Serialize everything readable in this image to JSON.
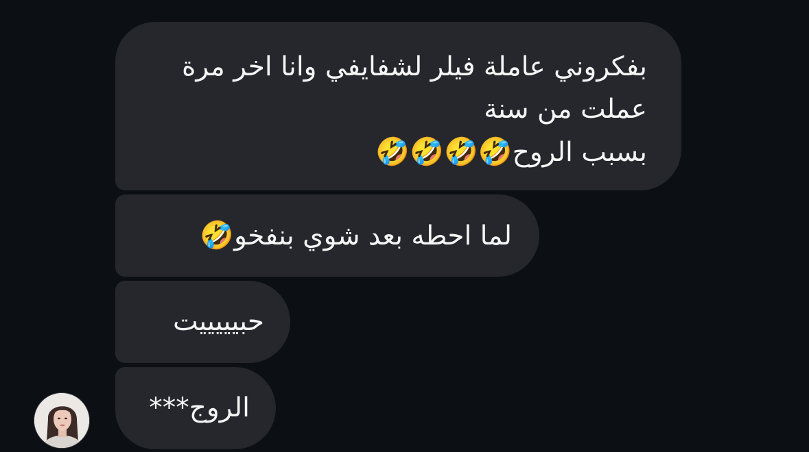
{
  "messages": [
    {
      "line1": "بفكروني عاملة فيلر لشفايفي وانا اخر مرة",
      "line2": "عملت من سنة",
      "line3_text": "بسبب الروح",
      "line3_emoji": "🤣🤣🤣🤣"
    },
    {
      "text": "لما احطه بعد شوي بنفخو",
      "emoji": "🤣"
    },
    {
      "text": "حبيييييت"
    },
    {
      "text": "الروج***"
    }
  ],
  "sender_avatar": {
    "icon": "profile-photo"
  },
  "colors": {
    "background": "#0c1014",
    "bubble": "#25272c",
    "text": "#f5f5f5"
  }
}
